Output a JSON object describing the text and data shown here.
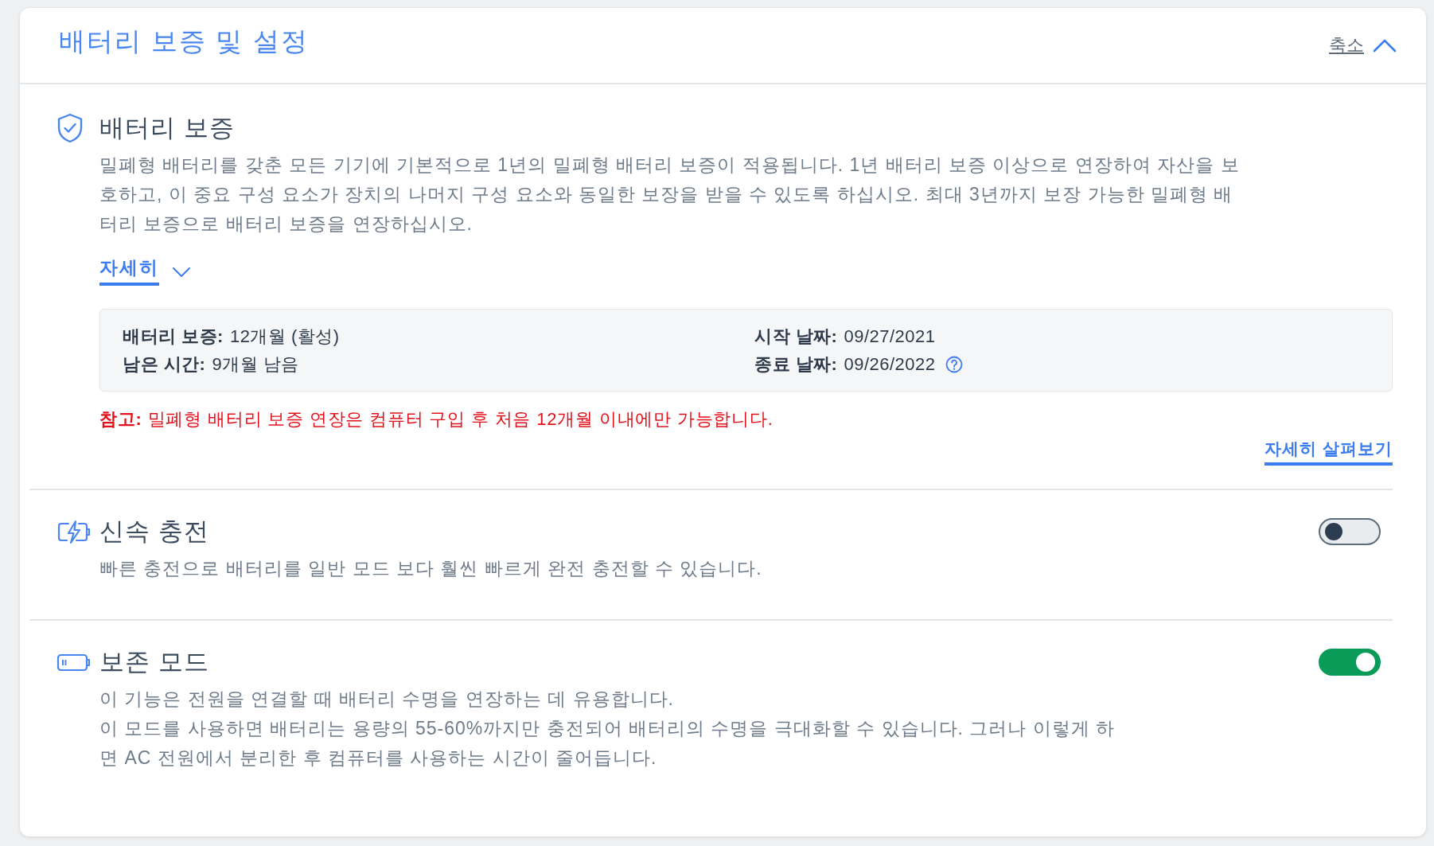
{
  "header": {
    "title": "배터리 보증 및 설정",
    "collapse_button": {
      "label": "축소",
      "expanded": true
    }
  },
  "warranty": {
    "title": "배터리 보증",
    "description": "밀폐형 배터리를 갖춘 모든 기기에 기본적으로 1년의 밀폐형 배터리 보증이 적용됩니다. 1년 배터리 보증 이상으로 연장하여 자산을 보호하고, 이 중요 구성 요소가 장치의 나머지 구성 요소와 동일한 보장을 받을 수 있도록 하십시오. 최대 3년까지 보장 가능한 밀폐형 배터리 보증으로 배터리 보증을 연장하십시오.",
    "details_toggle": {
      "label": "자세히",
      "expanded": false
    },
    "info": [
      {
        "label": "배터리 보증:",
        "value": "12개월 (활성)",
        "help": false
      },
      {
        "label": "시작 날짜:",
        "value": "09/27/2021",
        "help": false
      },
      {
        "label": "남은 시간:",
        "value": "9개월 남음",
        "help": false
      },
      {
        "label": "종료 날짜:",
        "value": "09/26/2022",
        "help": true
      }
    ],
    "note": "**참고:** 밀폐형 배터리 보증 연장은 컴퓨터 구입 후 처음 12개월 이내에만 가능합니다.",
    "learn_more_link": "자세히 살펴보기"
  },
  "settings": [
    {
      "title": "신속 충전",
      "description": [
        "빠른 충전으로 배터리를 일반 모드 보다 훨씬 빠르게 완전 충전할 수 있습니다."
      ],
      "on": false
    },
    {
      "title": "보존 모드",
      "description": [
        "이 기능은 전원을 연결할 때 배터리 수명을 연장하는 데 유용합니다.",
        "이 모드를 사용하면 배터리는 용량의 55-60%까지만 충전되어 배터리의 수명을 극대화할 수 있습니다. 그러나 이렇게 하면 AC 전원에서 분리한 후 컴퓨터를 사용하는 시간이 줄어듭니다."
      ],
      "on": true
    }
  ]
}
